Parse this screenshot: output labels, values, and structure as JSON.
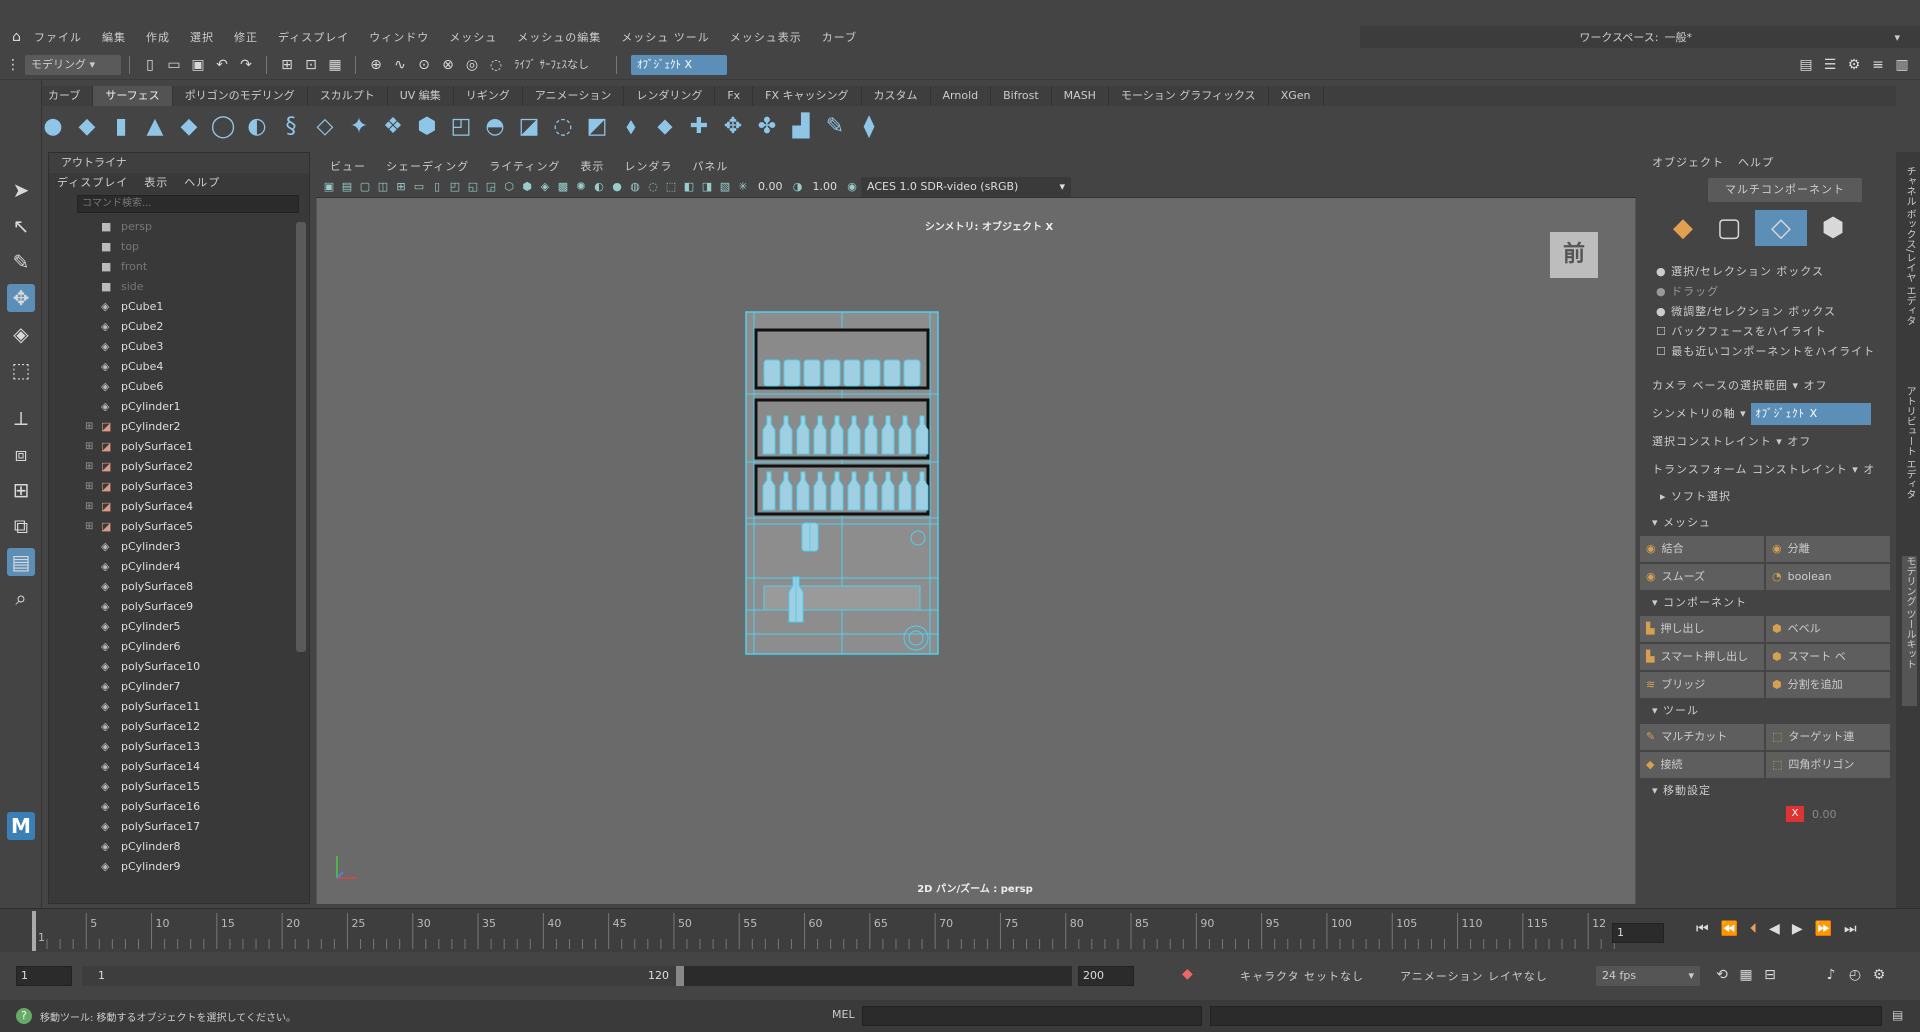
{
  "menubar": {
    "items": [
      "ファイル",
      "編集",
      "作成",
      "選択",
      "修正",
      "ディスプレイ",
      "ウィンドウ",
      "メッシュ",
      "メッシュの編集",
      "メッシュ ツール",
      "メッシュ表示",
      "カーブ"
    ],
    "workspace_label": "ワークスペース:",
    "workspace_value": "一般*"
  },
  "toolbar": {
    "mode": "モデリング",
    "live_surface": "ﾗｲﾌﾞ ｻｰﾌｪｽなし",
    "symmetry": "ｵﾌﾞｼﾞｪｸﾄ X"
  },
  "shelf_tabs": [
    "カーブ",
    "サーフェス",
    "ポリゴンのモデリング",
    "スカルプト",
    "UV 編集",
    "リギング",
    "アニメーション",
    "レンダリング",
    "Fx",
    "FX キャッシング",
    "カスタム",
    "Arnold",
    "Bifrost",
    "MASH",
    "モーション グラフィックス",
    "XGen"
  ],
  "shelf_active": "サーフェス",
  "outliner": {
    "title": "アウトライナ",
    "menu": [
      "ディスプレイ",
      "表示",
      "ヘルプ"
    ],
    "search_placeholder": "コマンド検索...",
    "items": [
      {
        "name": "persp",
        "type": "camera",
        "expandable": false
      },
      {
        "name": "top",
        "type": "camera",
        "expandable": false
      },
      {
        "name": "front",
        "type": "camera",
        "expandable": false
      },
      {
        "name": "side",
        "type": "camera",
        "expandable": false
      },
      {
        "name": "pCube1",
        "type": "mesh",
        "expandable": false
      },
      {
        "name": "pCube2",
        "type": "mesh",
        "expandable": false
      },
      {
        "name": "pCube3",
        "type": "mesh",
        "expandable": false
      },
      {
        "name": "pCube4",
        "type": "mesh",
        "expandable": false
      },
      {
        "name": "pCube6",
        "type": "mesh",
        "expandable": false
      },
      {
        "name": "pCylinder1",
        "type": "mesh",
        "expandable": false
      },
      {
        "name": "pCylinder2",
        "type": "group",
        "expandable": true
      },
      {
        "name": "polySurface1",
        "type": "group",
        "expandable": true
      },
      {
        "name": "polySurface2",
        "type": "group",
        "expandable": true
      },
      {
        "name": "polySurface3",
        "type": "group",
        "expandable": true
      },
      {
        "name": "polySurface4",
        "type": "group",
        "expandable": true
      },
      {
        "name": "polySurface5",
        "type": "group",
        "expandable": true
      },
      {
        "name": "pCylinder3",
        "type": "mesh",
        "expandable": false
      },
      {
        "name": "pCylinder4",
        "type": "mesh",
        "expandable": false
      },
      {
        "name": "polySurface8",
        "type": "mesh",
        "expandable": false
      },
      {
        "name": "polySurface9",
        "type": "mesh",
        "expandable": false
      },
      {
        "name": "pCylinder5",
        "type": "mesh",
        "expandable": false
      },
      {
        "name": "pCylinder6",
        "type": "mesh",
        "expandable": false
      },
      {
        "name": "polySurface10",
        "type": "mesh",
        "expandable": false
      },
      {
        "name": "pCylinder7",
        "type": "mesh",
        "expandable": false
      },
      {
        "name": "polySurface11",
        "type": "mesh",
        "expandable": false
      },
      {
        "name": "polySurface12",
        "type": "mesh",
        "expandable": false
      },
      {
        "name": "polySurface13",
        "type": "mesh",
        "expandable": false
      },
      {
        "name": "polySurface14",
        "type": "mesh",
        "expandable": false
      },
      {
        "name": "polySurface15",
        "type": "mesh",
        "expandable": false
      },
      {
        "name": "polySurface16",
        "type": "mesh",
        "expandable": false
      },
      {
        "name": "polySurface17",
        "type": "mesh",
        "expandable": false
      },
      {
        "name": "pCylinder8",
        "type": "mesh",
        "expandable": false
      },
      {
        "name": "pCylinder9",
        "type": "mesh",
        "expandable": false
      }
    ]
  },
  "viewport": {
    "menu": [
      "ビュー",
      "シェーディング",
      "ライティング",
      "表示",
      "レンダラ",
      "パネル"
    ],
    "value_a": "0.00",
    "value_b": "1.00",
    "colorspace": "ACES 1.0 SDR-video (sRGB)",
    "symmetry_label": "シンメトリ: オブジェクト X",
    "view_label": "前",
    "camera_label": "2D パン/ズーム : persp"
  },
  "right_panel": {
    "menu": [
      "オブジェクト",
      "ヘルプ"
    ],
    "multi_component": "マルチコンポーネント",
    "options": [
      "選択/セレクション ボックス",
      "ドラッグ",
      "微調整/セレクション ボックス",
      "バックフェースをハイライト",
      "最も近いコンポーネントをハイライト"
    ],
    "camera_select_label": "カメラ ベースの選択範囲",
    "camera_select_value": "オフ",
    "sym_axis_label": "シンメトリの軸",
    "sym_axis_value": "ｵﾌﾞｼﾞｪｸﾄ X",
    "select_constraint_label": "選択コンストレイント",
    "select_constraint_value": "オフ",
    "transform_constraint_label": "トランスフォーム コンストレイント",
    "transform_constraint_value": "オ",
    "soft_select": "ソフト選択",
    "mesh_section": "メッシュ",
    "mesh_buttons": [
      "結合",
      "分離",
      "スムーズ",
      "boolean"
    ],
    "component_section": "コンポーネント",
    "component_buttons": [
      "押し出し",
      "ベベル",
      "スマート押し出し",
      "スマート ベ",
      "ブリッジ",
      "分割を追加"
    ],
    "tool_section": "ツール",
    "tool_buttons": [
      "マルチカット",
      "ターゲット連",
      "接続",
      "四角ポリゴン"
    ],
    "move_section": "移動設定",
    "x_value": "0.00"
  },
  "right_tabs": [
    "チャネル ボックス/レイヤ エディタ",
    "アトリビュート エディタ",
    "モデリング ツールキット"
  ],
  "timeline": {
    "ticks": [
      "1",
      "5",
      "10",
      "15",
      "20",
      "25",
      "30",
      "35",
      "40",
      "45",
      "50",
      "55",
      "60",
      "65",
      "70",
      "75",
      "80",
      "85",
      "90",
      "95",
      "100",
      "105",
      "110",
      "115",
      "12"
    ],
    "current_frame": "1"
  },
  "range": {
    "start": "1",
    "range_start": "1",
    "range_end": "120",
    "end": "200",
    "character": "キャラクタ セットなし",
    "anim_layer": "アニメーション レイヤなし",
    "fps": "24 fps"
  },
  "status": {
    "message": "移動ツール: 移動するオブジェクトを選択してください。",
    "script_lang": "MEL"
  }
}
